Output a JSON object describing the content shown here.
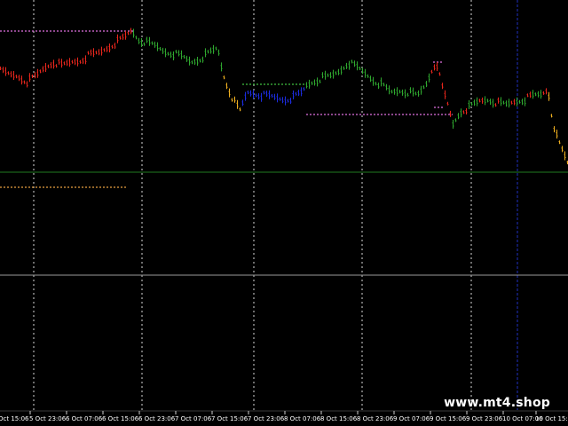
{
  "window": {
    "watermark": "www.mt4.shop"
  },
  "colors": {
    "background": "#000000",
    "grid": "#ffffff",
    "bull": "#2fa82f",
    "bear": "#e8261c",
    "neutral": "#1c2ce0",
    "warn": "#f0b020",
    "level_high": "#e070e0",
    "level_low": "#e8a040",
    "level_range": "#40c040",
    "horizontal_green": "#1f7a1f",
    "horizontal_gray": "#9a9a9a",
    "vertical_blue": "#2030c0"
  },
  "chart_data": {
    "type": "line",
    "title": "",
    "xlabel": "",
    "ylabel": "",
    "x_ticks": [
      "Oct 15:06",
      "5 Oct 23:06",
      "6 Oct 07:06",
      "6 Oct 15:06",
      "6 Oct 23:06",
      "7 Oct 07:06",
      "7 Oct 15:06",
      "7 Oct 23:06",
      "8 Oct 07:06",
      "8 Oct 15:06",
      "8 Oct 23:06",
      "9 Oct 07:06",
      "9 Oct 15:06",
      "9 Oct 23:06",
      "10 Oct 07:06",
      "10 Oct 15:0"
    ],
    "grid": true,
    "legend": "none"
  }
}
